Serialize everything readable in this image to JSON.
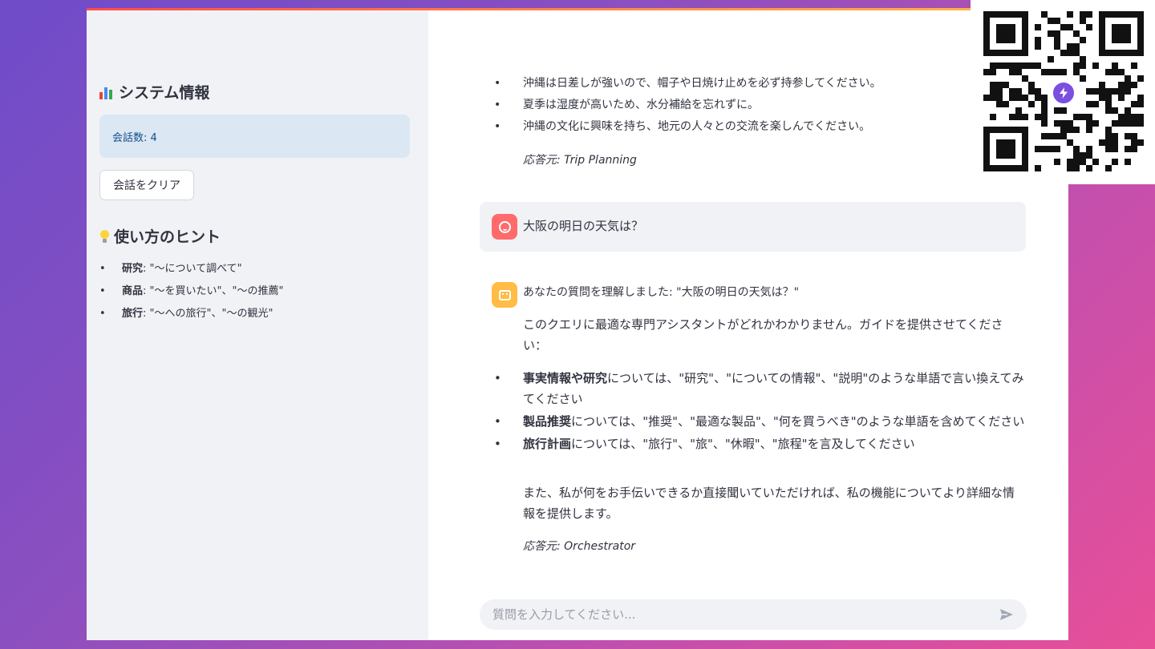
{
  "sidebar": {
    "system_info_title": "システム情報",
    "conversation_count": "会話数: 4",
    "clear_button": "会話をクリア",
    "hints_title": "使い方のヒント",
    "hints": [
      {
        "label": "研究",
        "text": ": \"〜について調べて\""
      },
      {
        "label": "商品",
        "text": ": \"〜を買いたい\"、\"〜の推薦\""
      },
      {
        "label": "旅行",
        "text": ": \"〜への旅行\"、\"〜の観光\""
      }
    ]
  },
  "chat": {
    "prev_bullets": [
      "沖縄は日差しが強いので、帽子や日焼け止めを必ず持参してください。",
      "夏季は湿度が高いため、水分補給を忘れずに。",
      "沖縄の文化に興味を持ち、地元の人々との交流を楽しんでください。"
    ],
    "prev_source": "応答元: Trip Planning",
    "user_message": "大阪の明日の天気は？",
    "bot_intro": "あなたの質問を理解しました: \"大阪の明日の天気は？\"",
    "bot_para1": "このクエリに最適な専門アシスタントがどれかわかりません。ガイドを提供させてください：",
    "bot_bullets": [
      {
        "bold": "事実情報や研究",
        "text": "については、\"研究\"、\"についての情報\"、\"説明\"のような単語で言い換えてみてください"
      },
      {
        "bold": "製品推奨",
        "text": "については、\"推奨\"、\"最適な製品\"、\"何を買うべき\"のような単語を含めてください"
      },
      {
        "bold": "旅行計画",
        "text": "については、\"旅行\"、\"旅\"、\"休暇\"、\"旅程\"を言及してください"
      }
    ],
    "bot_para2": "また、私が何をお手伝いできるか直接聞いていただければ、私の機能についてより詳細な情報を提供します。",
    "bot_source": "応答元: Orchestrator",
    "input_placeholder": "質問を入力してください..."
  },
  "icons": {
    "chart": "bar-chart-icon",
    "bulb": "lightbulb-icon",
    "user_avatar": "user-avatar-icon",
    "bot_avatar": "bot-avatar-icon",
    "send": "send-icon",
    "qr": "qr-code"
  },
  "colors": {
    "accent_red": "#ff4b4b",
    "accent_yellow": "#ffbd45",
    "info_bg": "#dce7f4",
    "info_text": "#124e8c",
    "qr_badge": "#7b4fe0"
  }
}
